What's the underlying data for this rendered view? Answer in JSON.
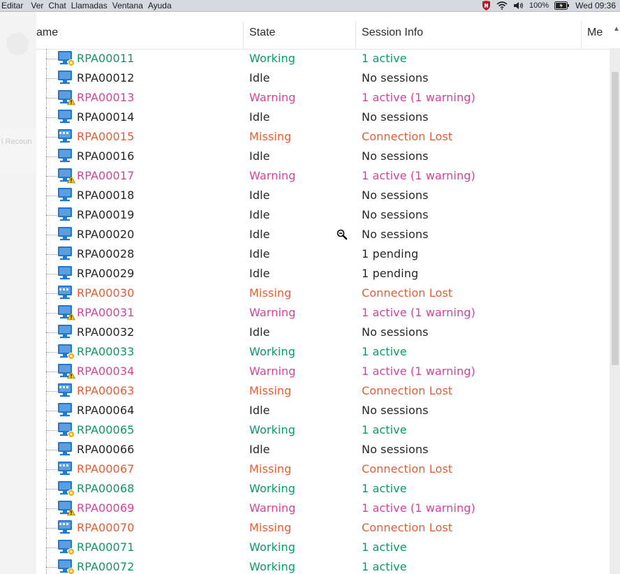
{
  "menubar": {
    "items": [
      "Editar",
      "Ver",
      "Chat",
      "Llamadas",
      "Ventana",
      "Ayuda"
    ],
    "battery": "100%",
    "clock": "Wed 09:36"
  },
  "sidebar": {
    "partial_label": "l Recoun"
  },
  "table": {
    "columns": {
      "name": "ame",
      "state": "State",
      "session": "Session Info",
      "me": "Me"
    },
    "rows": [
      {
        "name": "RPA00011",
        "state": "Working",
        "session": "1 active",
        "status": "working"
      },
      {
        "name": "RPA00012",
        "state": "Idle",
        "session": "No sessions",
        "status": "idle"
      },
      {
        "name": "RPA00013",
        "state": "Warning",
        "session": "1 active (1 warning)",
        "status": "warning"
      },
      {
        "name": "RPA00014",
        "state": "Idle",
        "session": "No sessions",
        "status": "idle"
      },
      {
        "name": "RPA00015",
        "state": "Missing",
        "session": "Connection Lost",
        "status": "missing"
      },
      {
        "name": "RPA00016",
        "state": "Idle",
        "session": "No sessions",
        "status": "idle"
      },
      {
        "name": "RPA00017",
        "state": "Warning",
        "session": "1 active (1 warning)",
        "status": "warning"
      },
      {
        "name": "RPA00018",
        "state": "Idle",
        "session": "No sessions",
        "status": "idle"
      },
      {
        "name": "RPA00019",
        "state": "Idle",
        "session": "No sessions",
        "status": "idle"
      },
      {
        "name": "RPA00020",
        "state": "Idle",
        "session": "No sessions",
        "status": "idle"
      },
      {
        "name": "RPA00028",
        "state": "Idle",
        "session": "1 pending",
        "status": "idle"
      },
      {
        "name": "RPA00029",
        "state": "Idle",
        "session": "1 pending",
        "status": "idle"
      },
      {
        "name": "RPA00030",
        "state": "Missing",
        "session": "Connection Lost",
        "status": "missing"
      },
      {
        "name": "RPA00031",
        "state": "Warning",
        "session": "1 active (1 warning)",
        "status": "warning"
      },
      {
        "name": "RPA00032",
        "state": "Idle",
        "session": "No sessions",
        "status": "idle"
      },
      {
        "name": "RPA00033",
        "state": "Working",
        "session": "1 active",
        "status": "working"
      },
      {
        "name": "RPA00034",
        "state": "Warning",
        "session": "1 active (1 warning)",
        "status": "warning"
      },
      {
        "name": "RPA00063",
        "state": "Missing",
        "session": "Connection Lost",
        "status": "missing"
      },
      {
        "name": "RPA00064",
        "state": "Idle",
        "session": "No sessions",
        "status": "idle"
      },
      {
        "name": "RPA00065",
        "state": "Working",
        "session": "1 active",
        "status": "working"
      },
      {
        "name": "RPA00066",
        "state": "Idle",
        "session": "No sessions",
        "status": "idle"
      },
      {
        "name": "RPA00067",
        "state": "Missing",
        "session": "Connection Lost",
        "status": "missing"
      },
      {
        "name": "RPA00068",
        "state": "Working",
        "session": "1 active",
        "status": "working"
      },
      {
        "name": "RPA00069",
        "state": "Warning",
        "session": "1 active (1 warning)",
        "status": "warning"
      },
      {
        "name": "RPA00070",
        "state": "Missing",
        "session": "Connection Lost",
        "status": "missing"
      },
      {
        "name": "RPA00071",
        "state": "Working",
        "session": "1 active",
        "status": "working"
      },
      {
        "name": "RPA00072",
        "state": "Working",
        "session": "1 active",
        "status": "working"
      }
    ]
  },
  "colors": {
    "working": "#0a9a61",
    "idle": "#262626",
    "warning": "#d9409a",
    "missing": "#f1592b",
    "monitor": "#1f79d1"
  },
  "icons": {
    "working": "computer-working-icon",
    "idle": "computer-idle-icon",
    "warning": "computer-warning-icon",
    "missing": "computer-missing-icon"
  }
}
